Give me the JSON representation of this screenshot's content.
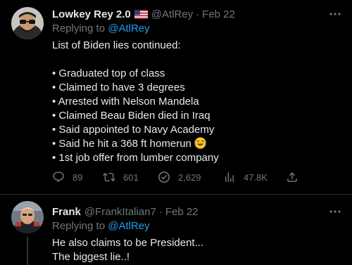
{
  "tweet1": {
    "name": "Lowkey Rey 2.0",
    "flag_icon": "us-flag-icon",
    "handle": "@AtlRey",
    "separator": "·",
    "date": "Feb 22",
    "replying_prefix": "Replying to",
    "replying_to": "@AtlRey",
    "text_lines": [
      "List of Biden lies continued:",
      "",
      "• Graduated top of class",
      "• Claimed to have 3 degrees",
      "• Arrested with Nelson Mandela",
      "• Claimed Beau Biden died in Iraq",
      "• Said appointed to Navy Academy",
      "• Said he hit a 368 ft homerun",
      "• 1st job offer from lumber company"
    ],
    "emoji": "tears-of-joy-emoji",
    "actions": {
      "replies": "89",
      "retweets": "601",
      "likes": "2,629",
      "views": "47.8K"
    }
  },
  "tweet2": {
    "name": "Frank",
    "handle": "@FrankItalian7",
    "separator": "·",
    "date": "Feb 22",
    "replying_prefix": "Replying to",
    "replying_to": "@AtlRey",
    "text_lines": [
      "He also claims to be President...",
      "The biggest lie..!"
    ]
  },
  "colors": {
    "background": "#000000",
    "text": "#e7e9ea",
    "muted": "#71767b",
    "accent": "#1d9bf0",
    "divider": "#2f3336"
  }
}
